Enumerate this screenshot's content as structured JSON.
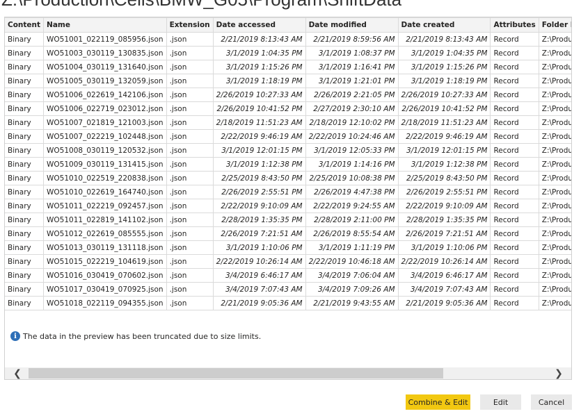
{
  "title": "Z:\\Production\\Cells\\BMW_G05\\Program\\ShiftData",
  "table": {
    "columns": [
      "Content",
      "Name",
      "Extension",
      "Date accessed",
      "Date modified",
      "Date created",
      "Attributes",
      "Folder Pat"
    ],
    "rows": [
      [
        "Binary",
        "WO51001_022119_085956.json",
        ".json",
        "2/21/2019 8:13:43 AM",
        "2/21/2019 8:59:56 AM",
        "2/21/2019 8:13:43 AM",
        "Record",
        "Z:\\Product"
      ],
      [
        "Binary",
        "WO51003_030119_130835.json",
        ".json",
        "3/1/2019 1:04:35 PM",
        "3/1/2019 1:08:37 PM",
        "3/1/2019 1:04:35 PM",
        "Record",
        "Z:\\Product"
      ],
      [
        "Binary",
        "WO51004_030119_131640.json",
        ".json",
        "3/1/2019 1:15:26 PM",
        "3/1/2019 1:16:41 PM",
        "3/1/2019 1:15:26 PM",
        "Record",
        "Z:\\Product"
      ],
      [
        "Binary",
        "WO51005_030119_132059.json",
        ".json",
        "3/1/2019 1:18:19 PM",
        "3/1/2019 1:21:01 PM",
        "3/1/2019 1:18:19 PM",
        "Record",
        "Z:\\Product"
      ],
      [
        "Binary",
        "WO51006_022619_142106.json",
        ".json",
        "2/26/2019 10:27:33 AM",
        "2/26/2019 2:21:05 PM",
        "2/26/2019 10:27:33 AM",
        "Record",
        "Z:\\Product"
      ],
      [
        "Binary",
        "WO51006_022719_023012.json",
        ".json",
        "2/26/2019 10:41:52 PM",
        "2/27/2019 2:30:10 AM",
        "2/26/2019 10:41:52 PM",
        "Record",
        "Z:\\Product"
      ],
      [
        "Binary",
        "WO51007_021819_121003.json",
        ".json",
        "2/18/2019 11:51:23 AM",
        "2/18/2019 12:10:02 PM",
        "2/18/2019 11:51:23 AM",
        "Record",
        "Z:\\Product"
      ],
      [
        "Binary",
        "WO51007_022219_102448.json",
        ".json",
        "2/22/2019 9:46:19 AM",
        "2/22/2019 10:24:46 AM",
        "2/22/2019 9:46:19 AM",
        "Record",
        "Z:\\Product"
      ],
      [
        "Binary",
        "WO51008_030119_120532.json",
        ".json",
        "3/1/2019 12:01:15 PM",
        "3/1/2019 12:05:33 PM",
        "3/1/2019 12:01:15 PM",
        "Record",
        "Z:\\Product"
      ],
      [
        "Binary",
        "WO51009_030119_131415.json",
        ".json",
        "3/1/2019 1:12:38 PM",
        "3/1/2019 1:14:16 PM",
        "3/1/2019 1:12:38 PM",
        "Record",
        "Z:\\Product"
      ],
      [
        "Binary",
        "WO51010_022519_220838.json",
        ".json",
        "2/25/2019 8:43:50 PM",
        "2/25/2019 10:08:38 PM",
        "2/25/2019 8:43:50 PM",
        "Record",
        "Z:\\Product"
      ],
      [
        "Binary",
        "WO51010_022619_164740.json",
        ".json",
        "2/26/2019 2:55:51 PM",
        "2/26/2019 4:47:38 PM",
        "2/26/2019 2:55:51 PM",
        "Record",
        "Z:\\Product"
      ],
      [
        "Binary",
        "WO51011_022219_092457.json",
        ".json",
        "2/22/2019 9:10:09 AM",
        "2/22/2019 9:24:55 AM",
        "2/22/2019 9:10:09 AM",
        "Record",
        "Z:\\Product"
      ],
      [
        "Binary",
        "WO51011_022819_141102.json",
        ".json",
        "2/28/2019 1:35:35 PM",
        "2/28/2019 2:11:00 PM",
        "2/28/2019 1:35:35 PM",
        "Record",
        "Z:\\Product"
      ],
      [
        "Binary",
        "WO51012_022619_085555.json",
        ".json",
        "2/26/2019 7:21:51 AM",
        "2/26/2019 8:55:54 AM",
        "2/26/2019 7:21:51 AM",
        "Record",
        "Z:\\Product"
      ],
      [
        "Binary",
        "WO51013_030119_131118.json",
        ".json",
        "3/1/2019 1:10:06 PM",
        "3/1/2019 1:11:19 PM",
        "3/1/2019 1:10:06 PM",
        "Record",
        "Z:\\Product"
      ],
      [
        "Binary",
        "WO51015_022219_104619.json",
        ".json",
        "2/22/2019 10:26:14 AM",
        "2/22/2019 10:46:18 AM",
        "2/22/2019 10:26:14 AM",
        "Record",
        "Z:\\Product"
      ],
      [
        "Binary",
        "WO51016_030419_070602.json",
        ".json",
        "3/4/2019 6:46:17 AM",
        "3/4/2019 7:06:04 AM",
        "3/4/2019 6:46:17 AM",
        "Record",
        "Z:\\Product"
      ],
      [
        "Binary",
        "WO51017_030419_070925.json",
        ".json",
        "3/4/2019 7:07:43 AM",
        "3/4/2019 7:09:26 AM",
        "3/4/2019 7:07:43 AM",
        "Record",
        "Z:\\Product"
      ],
      [
        "Binary",
        "WO51018_022119_094355.json",
        ".json",
        "2/21/2019 9:05:36 AM",
        "2/21/2019 9:43:55 AM",
        "2/21/2019 9:05:36 AM",
        "Record",
        "Z:\\Product"
      ]
    ]
  },
  "info": {
    "icon": "info-icon",
    "message": "The data in the preview has been truncated due to size limits."
  },
  "scrollbar": {
    "left_icon": "chevron-left-icon",
    "right_icon": "chevron-right-icon",
    "left_glyph": "❮",
    "right_glyph": "❯"
  },
  "buttons": {
    "combine_edit": "Combine & Edit",
    "edit": "Edit",
    "cancel": "Cancel"
  },
  "colors": {
    "primary_button": "#f2c811",
    "info_icon": "#2e6fb7"
  }
}
